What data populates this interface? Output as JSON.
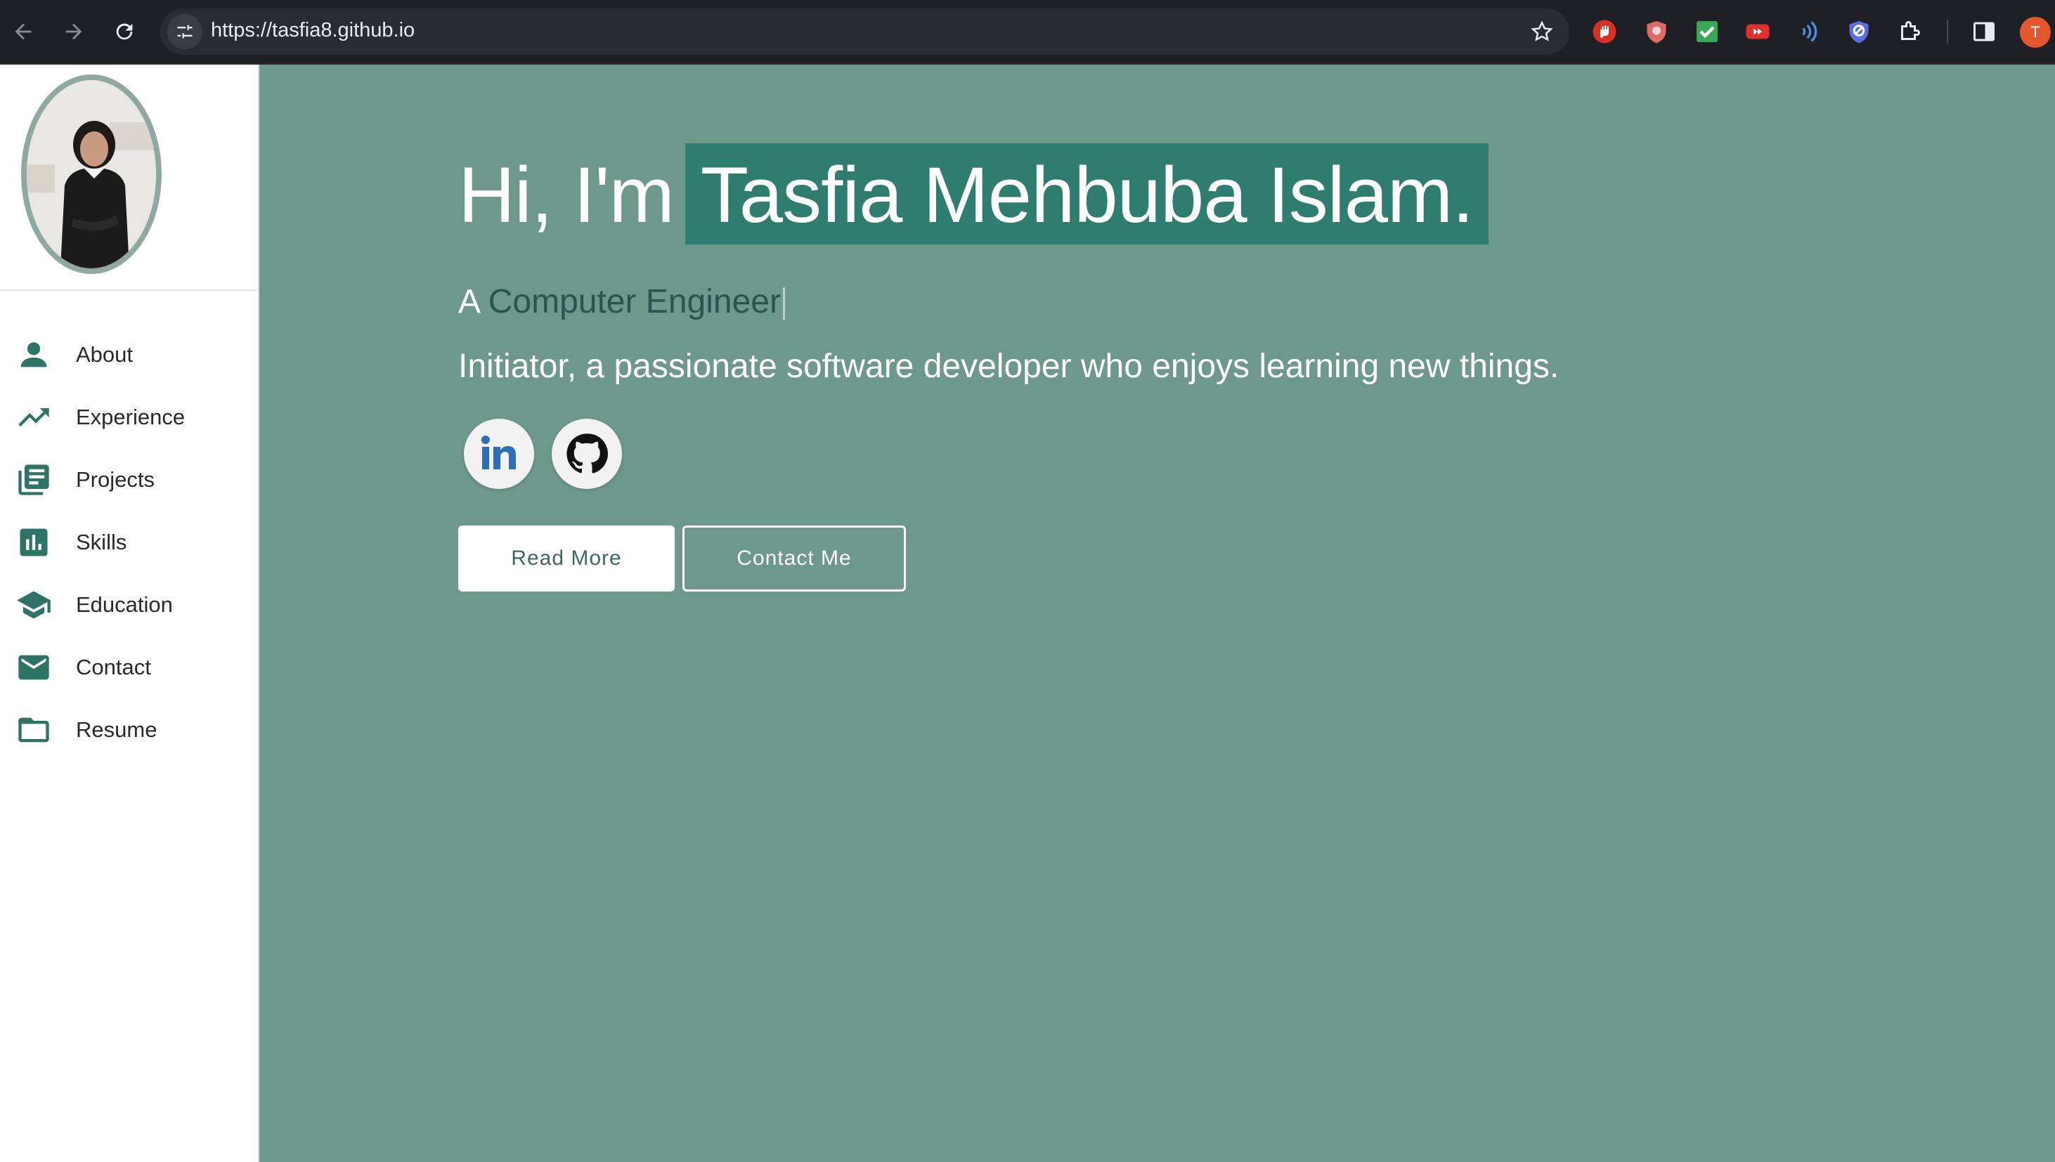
{
  "browser": {
    "url": "https://tasfia8.github.io",
    "profile_initial": "T",
    "extensions": [
      "stop-hand-icon",
      "shield-icon",
      "checkmark-icon",
      "youtube-icon",
      "wave-icon",
      "shield-check-icon",
      "puzzle-icon"
    ]
  },
  "sidebar": {
    "items": [
      {
        "label": "About",
        "icon": "person-icon"
      },
      {
        "label": "Experience",
        "icon": "trending-up-icon"
      },
      {
        "label": "Projects",
        "icon": "library-books-icon"
      },
      {
        "label": "Skills",
        "icon": "bar-chart-icon"
      },
      {
        "label": "Education",
        "icon": "graduation-cap-icon"
      },
      {
        "label": "Contact",
        "icon": "mail-icon"
      },
      {
        "label": "Resume",
        "icon": "folder-icon"
      }
    ]
  },
  "hero": {
    "greeting": "Hi, I'm",
    "name": "Tasfia Mehbuba Islam.",
    "role_prefix": "A",
    "role": "Computer Engineer",
    "tagline": "Initiator, a passionate software developer who enjoys learning new things.",
    "read_more": "Read More",
    "contact_me": "Contact Me"
  },
  "colors": {
    "accent": "#2e7466",
    "background": "#6f988d",
    "highlight": "#2f7d6f"
  }
}
